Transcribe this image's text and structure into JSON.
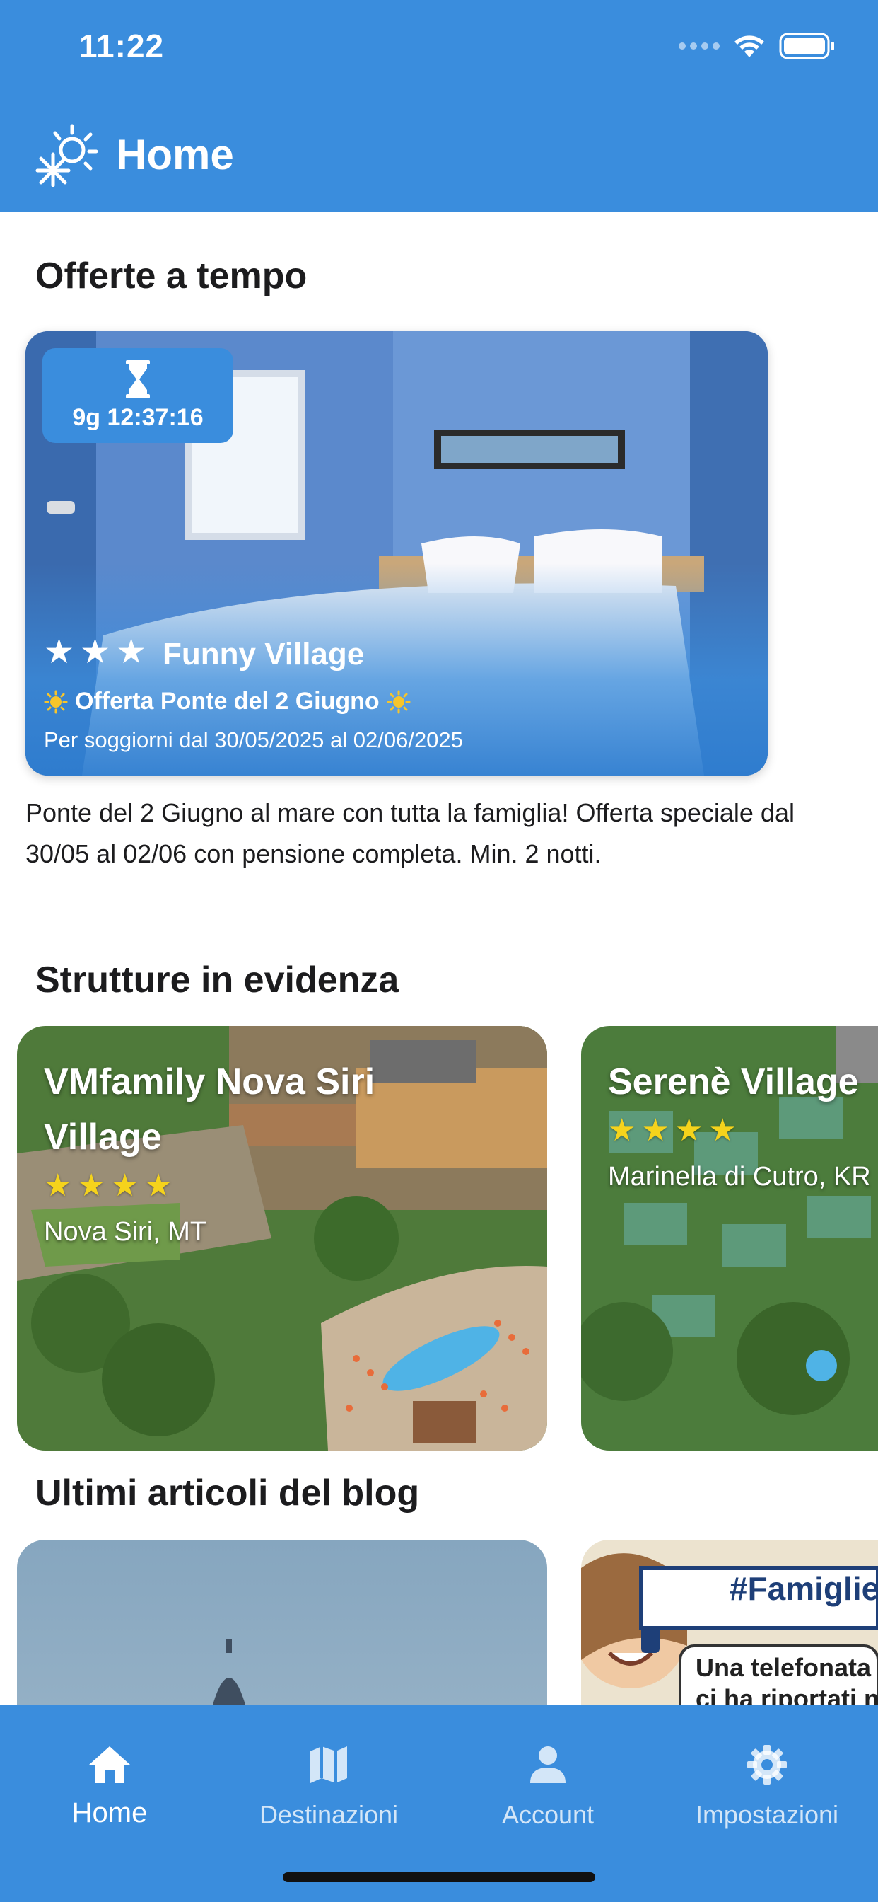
{
  "status_bar": {
    "time": "11:22"
  },
  "header": {
    "title": "Home"
  },
  "sections": {
    "offers": "Offerte a tempo",
    "structures": "Strutture in evidenza",
    "blog": "Ultimi articoli del blog"
  },
  "offer": {
    "timer": "9g 12:37:16",
    "stars": 3,
    "name": "Funny Village",
    "title": "Offerta Ponte del 2 Giugno",
    "dates": "Per soggiorni dal 30/05/2025 al 02/06/2025",
    "description": "Ponte del 2 Giugno al mare con tutta la famiglia! Offerta speciale dal 30/05 al 02/06 con pensione completa. Min. 2 notti."
  },
  "structures": [
    {
      "name": "VMfamily Nova Siri Village",
      "stars": 4,
      "location": "Nova Siri, MT"
    },
    {
      "name": "Serenè Village",
      "stars": 4,
      "location": "Marinella di Cutro, KR"
    }
  ],
  "blog": [
    {
      "image_text": ""
    },
    {
      "image_text_1": "#FamiglieF",
      "image_text_2": "Una telefonata con",
      "image_text_3": "ci ha riportati nella"
    }
  ],
  "nav": [
    {
      "label": "Home",
      "icon": "home-icon",
      "active": true
    },
    {
      "label": "Destinazioni",
      "icon": "map-icon",
      "active": false
    },
    {
      "label": "Account",
      "icon": "person-icon",
      "active": false
    },
    {
      "label": "Impostazioni",
      "icon": "gear-icon",
      "active": false
    }
  ],
  "colors": {
    "primary": "#3a8ddd",
    "star": "#f5d31c"
  }
}
